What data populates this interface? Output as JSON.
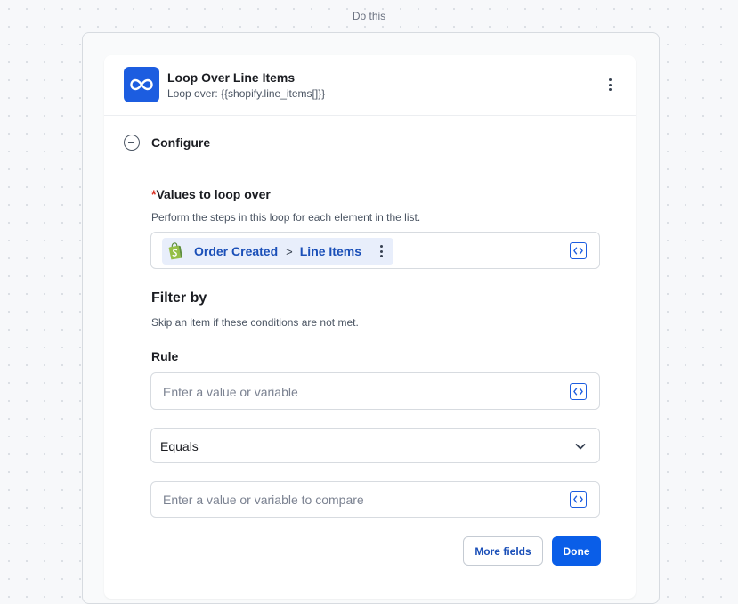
{
  "step_header": "Do this",
  "card": {
    "app_icon": "loop-icon",
    "title": "Loop Over Line Items",
    "subtitle": "Loop over: {{shopify.line_items[]}}",
    "menu_icon": "more-vertical-icon"
  },
  "configure": {
    "label": "Configure",
    "toggle_icon": "collapse-minus-icon"
  },
  "values_field": {
    "required_marker": "*",
    "label": "Values to loop over",
    "help": "Perform the steps in this loop for each element in the list.",
    "chip": {
      "icon": "shopify-icon",
      "source": "Order Created",
      "separator": ">",
      "field": "Line Items"
    }
  },
  "filter": {
    "title": "Filter by",
    "help": "Skip an item if these conditions are not met.",
    "rule_label": "Rule",
    "value_placeholder": "Enter a value or variable",
    "operator": "Equals",
    "compare_placeholder": "Enter a value or variable to compare"
  },
  "buttons": {
    "more_fields": "More fields",
    "done": "Done"
  },
  "colors": {
    "accent": "#1c5de0",
    "primary_button": "#0a5ee8",
    "required": "#d92d20",
    "chip_bg": "#e8eefb",
    "shopify_green": "#95bf47"
  }
}
